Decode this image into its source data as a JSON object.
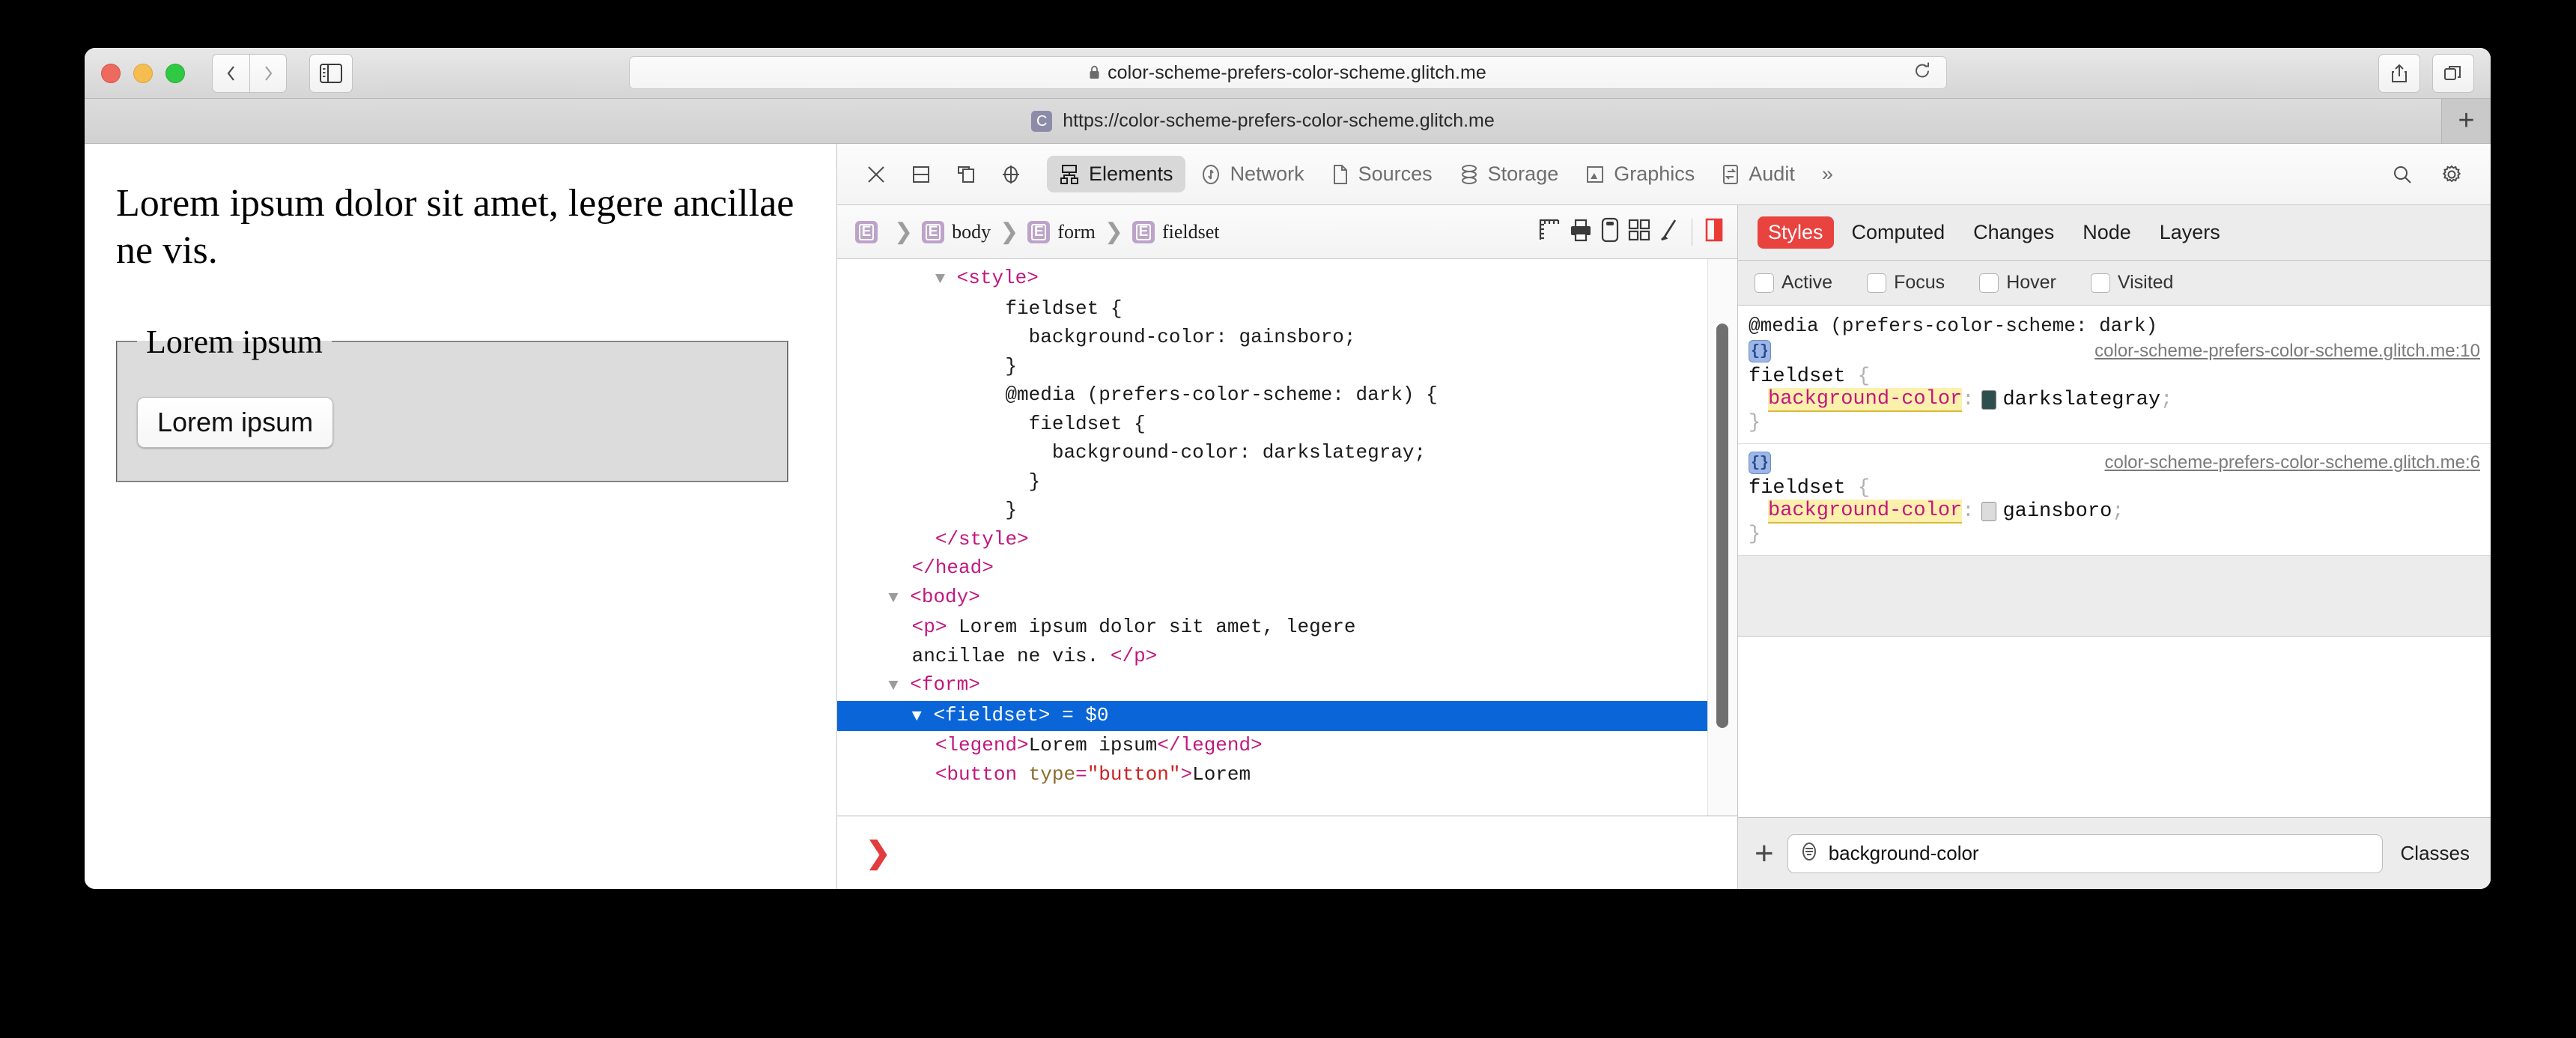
{
  "browser": {
    "traffic_lights": [
      "close",
      "minimize",
      "zoom"
    ],
    "nav": {
      "back": "back-arrow",
      "forward": "forward-arrow"
    },
    "sidebar_button": "show-sidebar",
    "address_bar": {
      "lock_icon": "lock-icon",
      "url": "color-scheme-prefers-color-scheme.glitch.me",
      "reload_icon": "reload-icon"
    },
    "toolbar_right": {
      "share": "share-icon",
      "tabs": "tab-overview-icon"
    },
    "tab": {
      "favicon_letter": "C",
      "title": "https://color-scheme-prefers-color-scheme.glitch.me"
    },
    "new_tab_label": "+"
  },
  "page": {
    "paragraph": "Lorem ipsum dolor sit amet, legere ancillae ne vis.",
    "legend": "Lorem ipsum",
    "button_label": "Lorem ipsum",
    "fieldset_bg": "#dcdcdc"
  },
  "devtools": {
    "toolbar_icons": [
      "close-icon",
      "dock-bottom-icon",
      "dock-separate-icon",
      "inspect-target-icon"
    ],
    "tabs": [
      {
        "label": "Elements",
        "icon": "elements-icon",
        "active": true
      },
      {
        "label": "Network",
        "icon": "network-icon",
        "active": false
      },
      {
        "label": "Sources",
        "icon": "sources-icon",
        "active": false
      },
      {
        "label": "Storage",
        "icon": "storage-icon",
        "active": false
      },
      {
        "label": "Graphics",
        "icon": "graphics-icon",
        "active": false
      },
      {
        "label": "Audit",
        "icon": "audit-icon",
        "active": false
      }
    ],
    "overflow_label": "»",
    "search_icon": "search-icon",
    "settings_icon": "gear-icon",
    "breadcrumb": [
      {
        "badge": "E",
        "label": ""
      },
      {
        "badge": "E",
        "label": "body"
      },
      {
        "badge": "E",
        "label": "form"
      },
      {
        "badge": "E",
        "label": "fieldset"
      }
    ],
    "breadcrumb_tools": [
      "layout-rulers-icon",
      "print-icon",
      "device-icon",
      "grid-icon",
      "paint-icon",
      "highlight-icon"
    ],
    "dom_lines": [
      {
        "indent": 4,
        "tri": true,
        "html": "<span class='tagc'>&lt;style&gt;</span>"
      },
      {
        "indent": 7,
        "tri": false,
        "html": "fieldset {"
      },
      {
        "indent": 8,
        "tri": false,
        "html": "background-color: gainsboro;"
      },
      {
        "indent": 7,
        "tri": false,
        "html": "}"
      },
      {
        "indent": 7,
        "tri": false,
        "html": "@media (prefers-color-scheme: dark) {"
      },
      {
        "indent": 8,
        "tri": false,
        "html": "fieldset {"
      },
      {
        "indent": 9,
        "tri": false,
        "html": "background-color: darkslategray;"
      },
      {
        "indent": 8,
        "tri": false,
        "html": "}"
      },
      {
        "indent": 7,
        "tri": false,
        "html": "}"
      },
      {
        "indent": 4,
        "tri": false,
        "html": "<span class='tagc'>&lt;/style&gt;</span>"
      },
      {
        "indent": 3,
        "tri": false,
        "html": "<span class='tagc'>&lt;/head&gt;</span>"
      },
      {
        "indent": 2,
        "tri": true,
        "html": "<span class='tagc'>&lt;body&gt;</span>"
      },
      {
        "indent": 3,
        "tri": false,
        "html": "<span class='tagc'>&lt;p&gt;</span> Lorem ipsum dolor sit amet, legere"
      },
      {
        "indent": 3,
        "tri": false,
        "html": "ancillae ne vis. <span class='tagc'>&lt;/p&gt;</span>"
      },
      {
        "indent": 2,
        "tri": true,
        "html": "<span class='tagc'>&lt;form&gt;</span>"
      },
      {
        "indent": 3,
        "tri": true,
        "selected": true,
        "html": "<span class='tagc'>&lt;fieldset&gt;</span> = $0"
      },
      {
        "indent": 4,
        "tri": false,
        "html": "<span class='tagc'>&lt;legend&gt;</span>Lorem ipsum<span class='tagc'>&lt;/legend&gt;</span>"
      },
      {
        "indent": 4,
        "tri": false,
        "html": "<span class='tagc'>&lt;button </span><span class='attrn'>type</span><span class='tagc'>=</span><span class='attrv'>\"button\"</span><span class='tagc'>&gt;</span>Lorem"
      }
    ],
    "console_prompt": "❯",
    "styles_panel": {
      "tabs": [
        {
          "label": "Styles",
          "active": true
        },
        {
          "label": "Computed",
          "active": false
        },
        {
          "label": "Changes",
          "active": false
        },
        {
          "label": "Node",
          "active": false
        },
        {
          "label": "Layers",
          "active": false
        }
      ],
      "pseudo_states": [
        {
          "label": "Active",
          "checked": false
        },
        {
          "label": "Focus",
          "checked": false
        },
        {
          "label": "Hover",
          "checked": false
        },
        {
          "label": "Visited",
          "checked": false
        }
      ],
      "rules": [
        {
          "media": "@media (prefers-color-scheme: dark)",
          "source": "color-scheme-prefers-color-scheme.glitch.me:10",
          "selector": "fieldset",
          "property": "background-color",
          "value": "darkslategray",
          "swatch": "#2f4f4f"
        },
        {
          "media": "",
          "source": "color-scheme-prefers-color-scheme.glitch.me:6",
          "selector": "fieldset",
          "property": "background-color",
          "value": "gainsboro",
          "swatch": "#dcdcdc"
        }
      ],
      "footer": {
        "add_label": "+",
        "filter_value": "background-color",
        "filter_icon": "filter-icon",
        "classes_label": "Classes"
      }
    }
  },
  "colors": {
    "accent_red": "#e8433f",
    "selection_blue": "#0a66d8",
    "tag_pink": "#c2187e",
    "highlight_yellow": "#fcf0ad"
  }
}
